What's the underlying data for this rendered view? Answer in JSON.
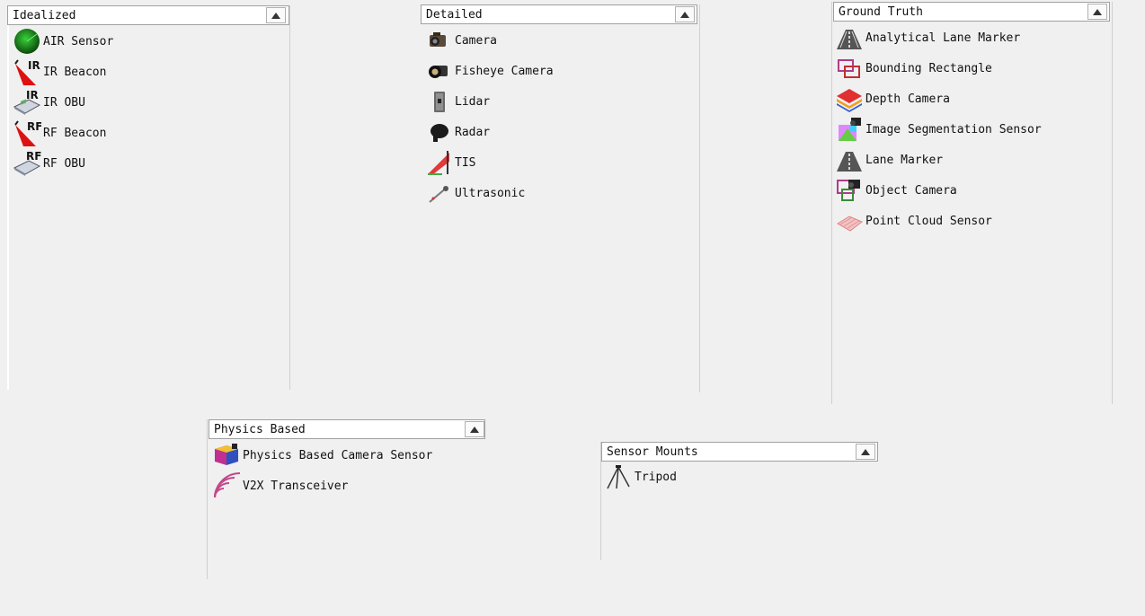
{
  "panels": {
    "idealized": {
      "title": "Idealized",
      "items": [
        {
          "label": "AIR Sensor",
          "icon": "radar-scope-icon"
        },
        {
          "label": "IR Beacon",
          "icon": "ir-beacon-icon"
        },
        {
          "label": "IR OBU",
          "icon": "ir-obu-icon"
        },
        {
          "label": "RF Beacon",
          "icon": "rf-beacon-icon"
        },
        {
          "label": "RF OBU",
          "icon": "rf-obu-icon"
        }
      ]
    },
    "detailed": {
      "title": "Detailed",
      "items": [
        {
          "label": "Camera",
          "icon": "camera-icon"
        },
        {
          "label": "Fisheye Camera",
          "icon": "fisheye-camera-icon"
        },
        {
          "label": "Lidar",
          "icon": "lidar-icon"
        },
        {
          "label": "Radar",
          "icon": "radar-icon"
        },
        {
          "label": "TIS",
          "icon": "tis-icon"
        },
        {
          "label": "Ultrasonic",
          "icon": "ultrasonic-icon"
        }
      ]
    },
    "ground_truth": {
      "title": "Ground Truth",
      "items": [
        {
          "label": "Analytical Lane Marker",
          "icon": "analytical-lane-marker-icon"
        },
        {
          "label": "Bounding Rectangle",
          "icon": "bounding-rectangle-icon"
        },
        {
          "label": "Depth Camera",
          "icon": "depth-camera-icon"
        },
        {
          "label": "Image Segmentation Sensor",
          "icon": "image-segmentation-icon"
        },
        {
          "label": "Lane Marker",
          "icon": "lane-marker-icon"
        },
        {
          "label": "Object Camera",
          "icon": "object-camera-icon"
        },
        {
          "label": "Point Cloud Sensor",
          "icon": "point-cloud-icon"
        }
      ]
    },
    "physics_based": {
      "title": "Physics Based",
      "items": [
        {
          "label": "Physics Based Camera Sensor",
          "icon": "physics-camera-icon"
        },
        {
          "label": "V2X Transceiver",
          "icon": "v2x-transceiver-icon"
        }
      ]
    },
    "sensor_mounts": {
      "title": "Sensor Mounts",
      "items": [
        {
          "label": "Tripod",
          "icon": "tripod-icon"
        }
      ]
    }
  },
  "colors": {
    "background": "#f0f0f0",
    "header_bg": "#ffffff",
    "header_border": "#a0a0a0",
    "ir_red": "#cc1111",
    "radar_green": "#1a8a1a",
    "v2x_pink": "#c04a8a"
  }
}
